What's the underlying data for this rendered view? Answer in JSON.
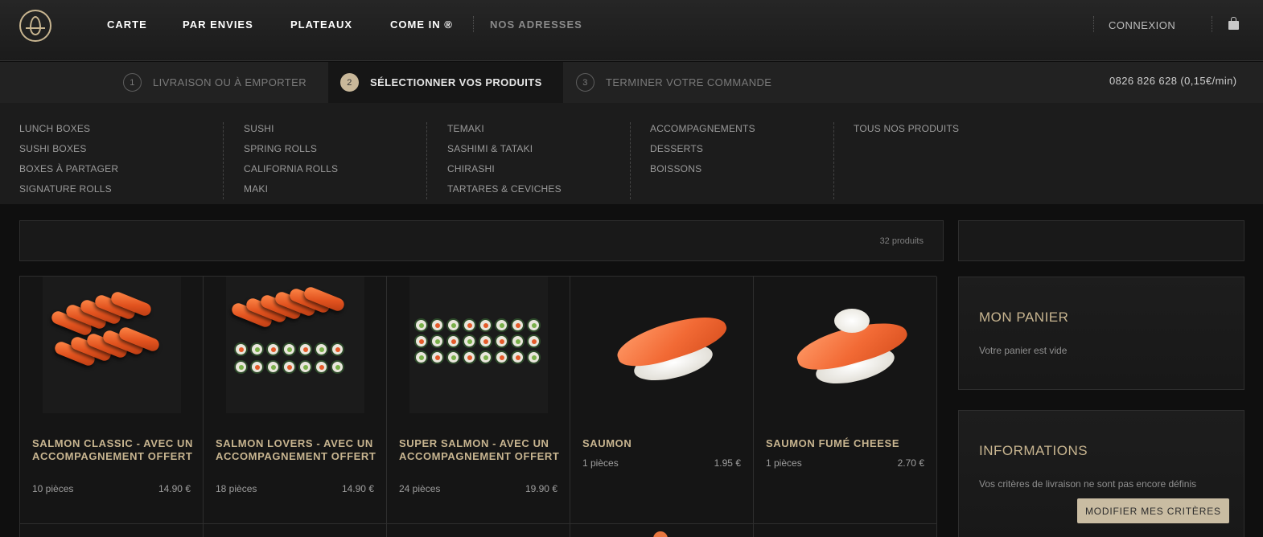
{
  "nav": {
    "items": [
      "CARTE",
      "PAR ENVIES",
      "PLATEAUX",
      "COME IN ®"
    ],
    "muted_item": "NOS ADRESSES",
    "login": "CONNEXION"
  },
  "steps": [
    {
      "num": "1",
      "label": "LIVRAISON OU À EMPORTER",
      "active": false
    },
    {
      "num": "2",
      "label": "SÉLECTIONNER VOS PRODUITS",
      "active": true
    },
    {
      "num": "3",
      "label": "TERMINER VOTRE COMMANDE",
      "active": false
    }
  ],
  "phone": "0826 826 628 (0,15€/min)",
  "categories": [
    [
      "LUNCH BOXES",
      "SUSHI BOXES",
      "BOXES À PARTAGER",
      "SIGNATURE ROLLS"
    ],
    [
      "SUSHI",
      "SPRING ROLLS",
      "CALIFORNIA ROLLS",
      "MAKI"
    ],
    [
      "TEMAKI",
      "SASHIMI & TATAKI",
      "CHIRASHI",
      "TARTARES & CEVICHES"
    ],
    [
      "ACCOMPAGNEMENTS",
      "DESSERTS",
      "BOISSONS"
    ],
    [
      "TOUS NOS PRODUITS"
    ]
  ],
  "product_count": "32 produits",
  "products": [
    {
      "name": "SALMON CLASSIC - AVEC UN ACCOMPAGNEMENT OFFERT",
      "pieces": "10 pièces",
      "price": "14.90 €"
    },
    {
      "name": "SALMON LOVERS - AVEC UN ACCOMPAGNEMENT OFFERT",
      "pieces": "18 pièces",
      "price": "14.90 €"
    },
    {
      "name": "SUPER SALMON - AVEC UN ACCOMPAGNEMENT OFFERT",
      "pieces": "24 pièces",
      "price": "19.90 €"
    },
    {
      "name": "SAUMON",
      "pieces": "1 pièces",
      "price": "1.95 €"
    },
    {
      "name": "SAUMON FUMÉ CHEESE",
      "pieces": "1 pièces",
      "price": "2.70 €"
    }
  ],
  "cart": {
    "title": "MON PANIER",
    "empty_text": "Votre panier est vide"
  },
  "info": {
    "title": "INFORMATIONS",
    "text": "Vos critères de livraison ne sont pas encore définis",
    "button": "MODIFIER MES CRITÈRES"
  },
  "colors": {
    "accent_gold": "#c8b590",
    "button_bg": "#c9bca2",
    "salmon": "#f26a35"
  }
}
